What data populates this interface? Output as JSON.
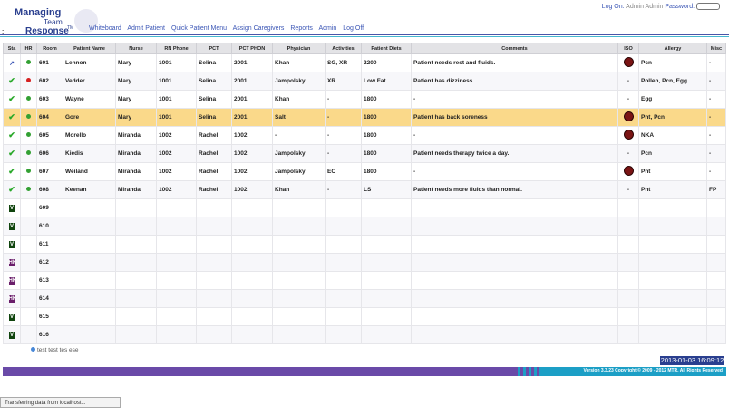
{
  "logo": {
    "line1": "Managing",
    "line2": "Team",
    "line3": "Response",
    "tm": "TM"
  },
  "nav": [
    "Whiteboard",
    "Admit Patient",
    "Quick Patient Menu",
    "Assign Caregivers",
    "Reports",
    "Admin",
    "Log Off"
  ],
  "logon": {
    "label": "Log On:",
    "user": "Admin Admin",
    "password_label": "Password:"
  },
  "colon": ":",
  "columns": [
    "Sta",
    "HR",
    "Room",
    "Patient Name",
    "Nurse",
    "RN Phone",
    "PCT",
    "PCT PHON",
    "Physician",
    "Activities",
    "Patient Diets",
    "Comments",
    "ISO",
    "Allergy",
    "Misc"
  ],
  "rows": [
    {
      "sta": "arrow",
      "hr": "green",
      "room": "601",
      "name": "Lennon",
      "nurse": "Mary",
      "rn_phone": "1001",
      "pct": "Selina",
      "pct_phone": "2001",
      "phys": "Khan",
      "act": "SG, XR",
      "diet": "2200",
      "comment": "Patient needs rest and fluids.",
      "iso": true,
      "allergy": "Pcn",
      "misc": "-"
    },
    {
      "sta": "check",
      "hr": "red",
      "room": "602",
      "name": "Vedder",
      "nurse": "Mary",
      "rn_phone": "1001",
      "pct": "Selina",
      "pct_phone": "2001",
      "phys": "Jampolsky",
      "act": "XR",
      "diet": "Low Fat",
      "comment": "Patient has dizziness",
      "iso": false,
      "iso_text": "-",
      "allergy": "Pollen, Pcn, Egg",
      "misc": "-"
    },
    {
      "sta": "check",
      "hr": "green",
      "room": "603",
      "name": "Wayne",
      "nurse": "Mary",
      "rn_phone": "1001",
      "pct": "Selina",
      "pct_phone": "2001",
      "phys": "Khan",
      "act": "-",
      "diet": "1800",
      "comment": "-",
      "iso": false,
      "iso_text": "-",
      "allergy": "Egg",
      "misc": "-"
    },
    {
      "sta": "check",
      "hr": "green",
      "room": "604",
      "name": "Gore",
      "nurse": "Mary",
      "rn_phone": "1001",
      "pct": "Selina",
      "pct_phone": "2001",
      "phys": "Salt",
      "act": "-",
      "diet": "1800",
      "comment": "Patient has back soreness",
      "iso": true,
      "allergy": "Pnt, Pcn",
      "misc": "-",
      "highlight": true
    },
    {
      "sta": "check",
      "hr": "green",
      "room": "605",
      "name": "Morello",
      "nurse": "Miranda",
      "rn_phone": "1002",
      "pct": "Rachel",
      "pct_phone": "1002",
      "phys": "-",
      "act": "-",
      "diet": "1800",
      "comment": "-",
      "iso": true,
      "allergy": "NKA",
      "misc": "-"
    },
    {
      "sta": "check",
      "hr": "green",
      "room": "606",
      "name": "Kiedis",
      "nurse": "Miranda",
      "rn_phone": "1002",
      "pct": "Rachel",
      "pct_phone": "1002",
      "phys": "Jampolsky",
      "act": "-",
      "diet": "1800",
      "comment": "Patient needs therapy twice a day.",
      "iso": false,
      "iso_text": "-",
      "allergy": "Pcn",
      "misc": "-"
    },
    {
      "sta": "check",
      "hr": "green",
      "room": "607",
      "name": "Weiland",
      "nurse": "Miranda",
      "rn_phone": "1002",
      "pct": "Rachel",
      "pct_phone": "1002",
      "phys": "Jampolsky",
      "act": "EC",
      "diet": "1800",
      "comment": "-",
      "iso": true,
      "allergy": "Pnt",
      "misc": "-"
    },
    {
      "sta": "check",
      "hr": "green",
      "room": "608",
      "name": "Keenan",
      "nurse": "Miranda",
      "rn_phone": "1002",
      "pct": "Rachel",
      "pct_phone": "1002",
      "phys": "Khan",
      "act": "-",
      "diet": "LS",
      "comment": "Patient needs more fluids than normal.",
      "iso": false,
      "iso_text": "-",
      "allergy": "Pnt",
      "misc": "FP"
    },
    {
      "sta": "V",
      "room": "609"
    },
    {
      "sta": "V",
      "room": "610"
    },
    {
      "sta": "V",
      "room": "611"
    },
    {
      "sta": "HK",
      "room": "612"
    },
    {
      "sta": "HK",
      "room": "613"
    },
    {
      "sta": "HK",
      "room": "614"
    },
    {
      "sta": "V",
      "room": "615"
    },
    {
      "sta": "V",
      "room": "616"
    }
  ],
  "legend": "test test tes ese",
  "clock": "2013-01-03 16:09:12",
  "footer": "Version 3.3.23  Copyright © 2009 - 2012 MTR. All Rights Reserved",
  "status": "Transferring data from localhost..."
}
